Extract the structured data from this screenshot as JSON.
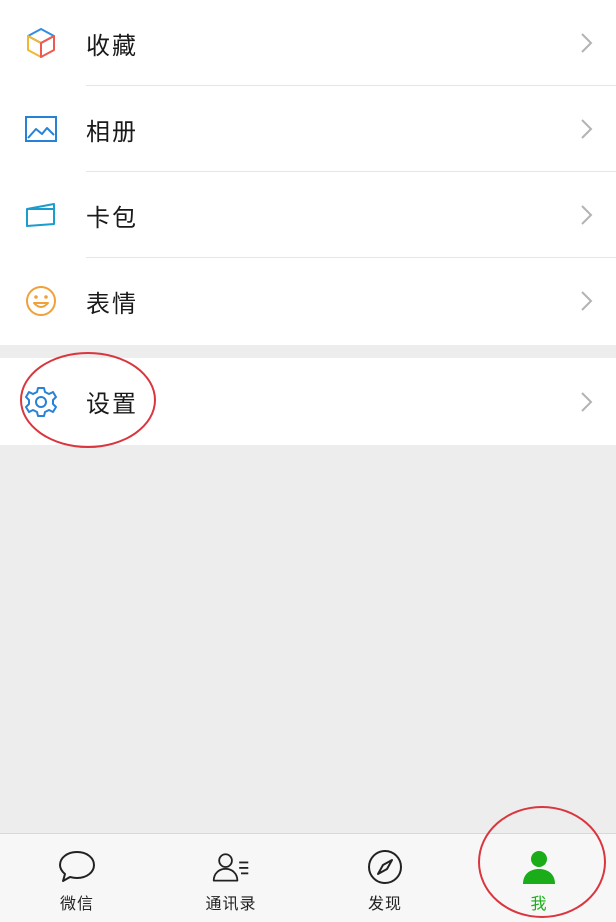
{
  "menu": {
    "items": [
      {
        "label": "收藏",
        "icon": "cube-icon"
      },
      {
        "label": "相册",
        "icon": "image-icon"
      },
      {
        "label": "卡包",
        "icon": "card-wallet-icon"
      },
      {
        "label": "表情",
        "icon": "smiley-icon"
      }
    ],
    "settings": {
      "label": "设置",
      "icon": "gear-icon"
    }
  },
  "tabbar": {
    "tabs": [
      {
        "label": "微信",
        "icon": "chat-bubble-icon"
      },
      {
        "label": "通讯录",
        "icon": "contacts-icon"
      },
      {
        "label": "发现",
        "icon": "compass-icon"
      },
      {
        "label": "我",
        "icon": "person-icon",
        "active": true
      }
    ]
  },
  "colors": {
    "accent": "#1aad19",
    "annotation": "#d9363e",
    "icon_blue": "#2782d7",
    "icon_orange": "#f0a137"
  }
}
